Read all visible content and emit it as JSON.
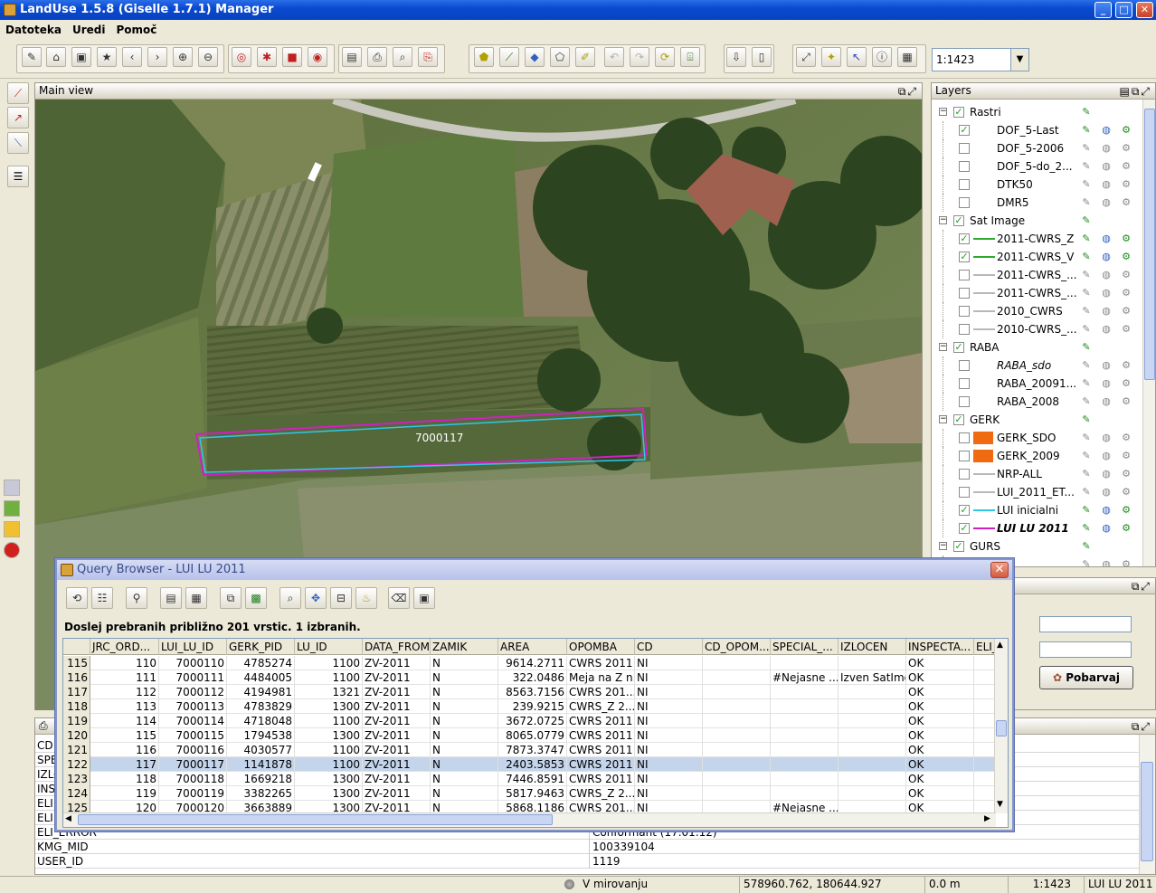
{
  "window": {
    "title": "LandUse 1.5.8 (Giselle 1.7.1) Manager"
  },
  "menu": [
    "Datoteka",
    "Uredi",
    "Pomoč"
  ],
  "toolbar": {
    "scale": "1:1423"
  },
  "main_view": {
    "title": "Main view",
    "parcel_label": "7000117"
  },
  "layers": {
    "title": "Layers",
    "groups": [
      {
        "name": "Rastri",
        "checked": true,
        "items": [
          {
            "name": "DOF_5-Last",
            "checked": true
          },
          {
            "name": "DOF_5-2006",
            "checked": false
          },
          {
            "name": "DOF_5-do_2...",
            "checked": false
          },
          {
            "name": "DTK50",
            "checked": false
          },
          {
            "name": "DMR5",
            "checked": false
          }
        ]
      },
      {
        "name": "Sat Image",
        "checked": true,
        "items": [
          {
            "name": "2011-CWRS_Z",
            "checked": true,
            "color": "#2eaa2e"
          },
          {
            "name": "2011-CWRS_V",
            "checked": true,
            "color": "#2eaa2e"
          },
          {
            "name": "2011-CWRS_...",
            "checked": false,
            "color": "#b8b8b8"
          },
          {
            "name": "2011-CWRS_...",
            "checked": false,
            "color": "#b8b8b8"
          },
          {
            "name": "2010_CWRS",
            "checked": false,
            "color": "#b8b8b8"
          },
          {
            "name": "2010-CWRS_...",
            "checked": false,
            "color": "#b8b8b8"
          }
        ]
      },
      {
        "name": "RABA",
        "checked": true,
        "items": [
          {
            "name": "RABA_sdo",
            "checked": false
          },
          {
            "name": "RABA_20091...",
            "checked": false
          },
          {
            "name": "RABA_2008",
            "checked": false
          }
        ]
      },
      {
        "name": "GERK",
        "checked": true,
        "items": [
          {
            "name": "GERK_SDO",
            "checked": false,
            "box": "#f06a10"
          },
          {
            "name": "GERK_2009",
            "checked": false,
            "box": "#f06a10"
          },
          {
            "name": "NRP-ALL",
            "checked": false,
            "color": "#b8b8b8"
          },
          {
            "name": "LUI_2011_ET...",
            "checked": false,
            "color": "#b8b8b8"
          },
          {
            "name": "LUI inicialni",
            "checked": true,
            "color": "#30c8e8"
          },
          {
            "name": "LUI LU 2011",
            "checked": true,
            "color": "#d020c0"
          }
        ]
      },
      {
        "name": "GURS",
        "checked": true,
        "items": [
          {
            "name": "...5",
            "checked": false
          }
        ]
      }
    ]
  },
  "side_panel": {
    "button": "Pobarvaj"
  },
  "attributes": {
    "rows": [
      {
        "key": "CD",
        "value": ""
      },
      {
        "key": "SPE",
        "value": ""
      },
      {
        "key": "IZLO",
        "value": ""
      },
      {
        "key": "INS",
        "value": ""
      },
      {
        "key": "ELI",
        "value": ""
      },
      {
        "key": "ELI",
        "value": ""
      },
      {
        "key": "ELI_ERROR",
        "value": "Conformant (17.01.12)"
      },
      {
        "key": "KMG_MID",
        "value": "100339104"
      },
      {
        "key": "USER_ID",
        "value": "1119"
      }
    ]
  },
  "query_browser": {
    "title": "Query Browser - LUI LU 2011",
    "status": "Doslej prebranih približno 201 vrstic. 1 izbranih.",
    "columns": [
      "",
      "JRC_ORD...",
      "LUI_LU_ID",
      "GERK_PID",
      "LU_ID",
      "DATA_FROM",
      "ZAMIK",
      "AREA",
      "OPOMBA",
      "CD",
      "CD_OPOM...",
      "SPECIAL_...",
      "IZLOCEN",
      "INSPECTA...",
      "ELI_"
    ],
    "rows": [
      [
        "115",
        "110",
        "7000110",
        "4785274",
        "1100",
        "ZV-2011",
        "N",
        "9614.2711",
        "CWRS 2011",
        "NI",
        "",
        "",
        "",
        "OK",
        ""
      ],
      [
        "116",
        "111",
        "7000111",
        "4484005",
        "1100",
        "ZV-2011",
        "N",
        "322.0486",
        "Meja na Z n...",
        "NI",
        "",
        "#Nejasne ...",
        "Izven SatImg",
        "OK",
        ""
      ],
      [
        "117",
        "112",
        "7000112",
        "4194981",
        "1321",
        "ZV-2011",
        "N",
        "8563.7156",
        "CWRS 201...",
        "NI",
        "",
        "",
        "",
        "OK",
        ""
      ],
      [
        "118",
        "113",
        "7000113",
        "4783829",
        "1300",
        "ZV-2011",
        "N",
        "239.9215",
        "CWRS_Z 2...",
        "NI",
        "",
        "",
        "",
        "OK",
        ""
      ],
      [
        "119",
        "114",
        "7000114",
        "4718048",
        "1100",
        "ZV-2011",
        "N",
        "3672.0725",
        "CWRS 2011",
        "NI",
        "",
        "",
        "",
        "OK",
        ""
      ],
      [
        "120",
        "115",
        "7000115",
        "1794538",
        "1300",
        "ZV-2011",
        "N",
        "8065.0779",
        "CWRS 2011",
        "NI",
        "",
        "",
        "",
        "OK",
        ""
      ],
      [
        "121",
        "116",
        "7000116",
        "4030577",
        "1100",
        "ZV-2011",
        "N",
        "7873.3747",
        "CWRS 2011",
        "NI",
        "",
        "",
        "",
        "OK",
        ""
      ],
      [
        "122",
        "117",
        "7000117",
        "1141878",
        "1100",
        "ZV-2011",
        "N",
        "2403.5853",
        "CWRS 2011",
        "NI",
        "",
        "",
        "",
        "OK",
        ""
      ],
      [
        "123",
        "118",
        "7000118",
        "1669218",
        "1300",
        "ZV-2011",
        "N",
        "7446.8591",
        "CWRS 2011",
        "NI",
        "",
        "",
        "",
        "OK",
        ""
      ],
      [
        "124",
        "119",
        "7000119",
        "3382265",
        "1300",
        "ZV-2011",
        "N",
        "5817.9463",
        "CWRS_Z 2...",
        "NI",
        "",
        "",
        "",
        "OK",
        ""
      ],
      [
        "125",
        "120",
        "7000120",
        "3663889",
        "1300",
        "ZV-2011",
        "N",
        "5868.1186",
        "CWRS 201...",
        "NI",
        "",
        "#Nejasne ...",
        "",
        "OK",
        ""
      ]
    ],
    "selected_row": 7
  },
  "statusbar": {
    "state": "V mirovanju",
    "coords": "578960.762, 180644.927",
    "distance": "0.0 m",
    "scale": "1:1423",
    "layer": "LUI LU 2011"
  }
}
